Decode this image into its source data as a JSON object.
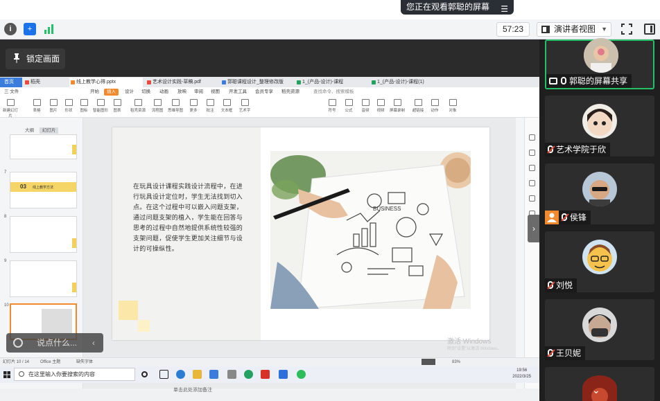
{
  "banner": {
    "sharing_text": "您正在观看郭聪的屏幕"
  },
  "toolbar": {
    "timer": "57:23",
    "view_mode": "演讲者视图"
  },
  "lock_screen_label": "锁定画面",
  "chat": {
    "placeholder": "说点什么..."
  },
  "shared_screen": {
    "tabs": [
      {
        "label": "首页"
      },
      {
        "label": "稻壳"
      },
      {
        "label": "线上教学心得.pptx"
      },
      {
        "label": "艺术设计实践-草稿.pdf"
      },
      {
        "label": "郭聪课程设计_整理修改版"
      },
      {
        "label": "1_(产品-设计)-课程"
      },
      {
        "label": "1_(产品-设计)-课程(1)"
      }
    ],
    "menu": [
      "三 文件",
      "开始",
      "插入",
      "设计",
      "切换",
      "动画",
      "放映",
      "审阅",
      "视图",
      "开发工具",
      "会员专享",
      "稻壳资源",
      "查找命令、搜索模板"
    ],
    "ribbon": [
      "新建幻灯片",
      "表格",
      "图片",
      "形状",
      "图标",
      "智能图形",
      "图表",
      "稻壳资源",
      "流程图",
      "思维导图",
      "更多",
      "批注",
      "文本框",
      "艺术字",
      "符号",
      "公式",
      "音频",
      "视频",
      "屏幕录制",
      "超链接",
      "动作",
      "对象"
    ],
    "outline_tabs": [
      "大纲",
      "幻灯片"
    ],
    "thumb_numbers": [
      "7",
      "8",
      "9",
      "10"
    ],
    "thumb_titles": [
      "03",
      "线上教学方法"
    ],
    "slide_text": "在玩具设计课程实践设计流程中，在进行玩具设计定位时，学生无法找到切入点。在这个过程中可以嵌入问题支架，通过问题支架的植入，学生能在回答与思考的过程中自然地提供系统性较强的支架问题，促使学生更加关注细节与设计的可操纵性。",
    "notes_placeholder": "单击此处添加备注",
    "activation": {
      "title": "激活 Windows",
      "subtitle": "转到\"设置\"以激活 Windows。"
    },
    "status": {
      "slide": "幻灯片 10 / 14",
      "theme": "Office 主题",
      "missing_font": "缺失字体",
      "zoom": "83%"
    },
    "taskbar": {
      "search": "在这里输入你要搜索的内容",
      "time": "19:56",
      "date": "2022/3/25"
    },
    "photo_label": "BUSINESS"
  },
  "participants": [
    {
      "name": "郭聪的屏幕共享",
      "state": "sharing"
    },
    {
      "name": "艺术学院于欣",
      "state": "muted"
    },
    {
      "name": "侯锋",
      "state": "muted-host"
    },
    {
      "name": "刘悦",
      "state": "muted"
    },
    {
      "name": "王贝妮",
      "state": "muted"
    }
  ],
  "colors": {
    "accent_green": "#24c268",
    "wps_orange": "#f08a2c",
    "mute_red": "#e84a3c",
    "taskbar_blue": "#3b7ddd"
  }
}
